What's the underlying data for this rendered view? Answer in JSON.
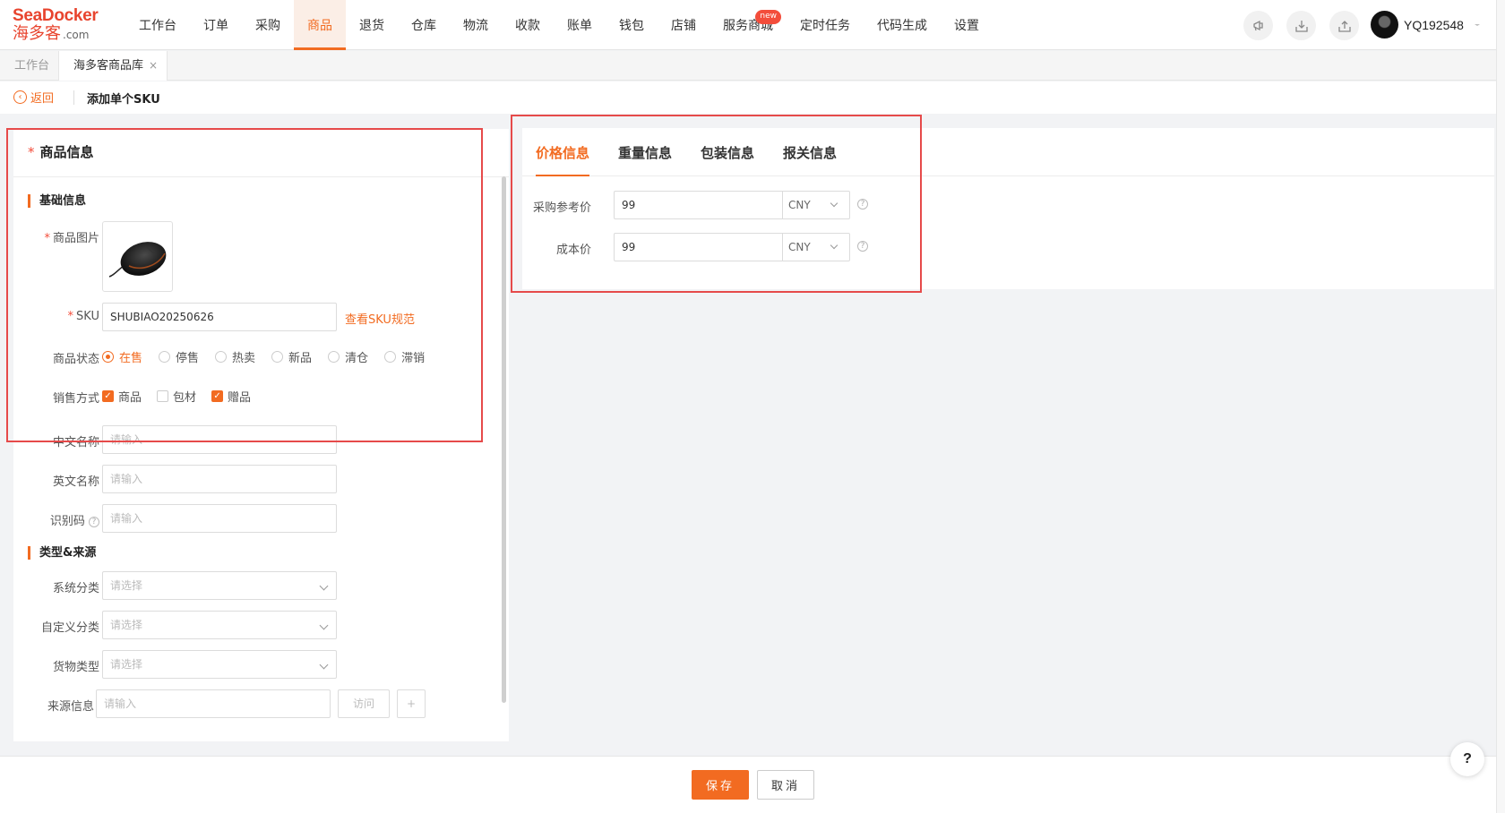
{
  "logo": {
    "line1": "SeaDocker",
    "line2": "海多客",
    "suffix": ".com"
  },
  "nav": {
    "items": [
      {
        "label": "工作台"
      },
      {
        "label": "订单"
      },
      {
        "label": "采购"
      },
      {
        "label": "商品"
      },
      {
        "label": "退货"
      },
      {
        "label": "仓库"
      },
      {
        "label": "物流"
      },
      {
        "label": "收款"
      },
      {
        "label": "账单"
      },
      {
        "label": "钱包"
      },
      {
        "label": "店铺"
      },
      {
        "label": "服务商城"
      },
      {
        "label": "定时任务"
      },
      {
        "label": "代码生成"
      },
      {
        "label": "设置"
      }
    ],
    "active": "商品",
    "badge_item": "服务商城",
    "badge": "new"
  },
  "top_icons": [
    "megaphone-icon",
    "download-icon",
    "upload-icon"
  ],
  "user": {
    "name": "YQ192548"
  },
  "tabs": [
    {
      "label": "工作台"
    },
    {
      "label": "海多客商品库",
      "close": "×"
    }
  ],
  "breadcrumb": {
    "back": "返回",
    "title": "添加单个SKU"
  },
  "product_info": {
    "title": "商品信息",
    "required_mark": "*",
    "basic_section": "基础信息",
    "image_label": "商品图片",
    "sku_label": "SKU",
    "sku_value": "SHUBIAO20250626",
    "sku_link": "查看SKU规范",
    "status_label": "商品状态",
    "status_options": [
      "在售",
      "停售",
      "热卖",
      "新品",
      "清仓",
      "滞销"
    ],
    "status_selected": "在售",
    "sale_label": "销售方式",
    "sale_options": [
      {
        "label": "商品",
        "checked": true
      },
      {
        "label": "包材",
        "checked": false
      },
      {
        "label": "赠品",
        "checked": true
      }
    ],
    "cn_name_label": "中文名称",
    "en_name_label": "英文名称",
    "code_label": "识别码",
    "input_placeholder": "请输入",
    "type_section": "类型&来源",
    "sys_cat_label": "系统分类",
    "custom_cat_label": "自定义分类",
    "goods_type_label": "货物类型",
    "select_placeholder": "请选择",
    "source_label": "来源信息",
    "source_btn": "访问",
    "source_add": "+"
  },
  "price_panel": {
    "tabs": [
      "价格信息",
      "重量信息",
      "包装信息",
      "报关信息"
    ],
    "active_tab": "价格信息",
    "rows": [
      {
        "label": "采购参考价",
        "value": "99",
        "currency": "CNY"
      },
      {
        "label": "成本价",
        "value": "99",
        "currency": "CNY"
      }
    ]
  },
  "footer": {
    "save": "保存",
    "cancel": "取消"
  },
  "help_fab": "?",
  "colors": {
    "accent": "#f26b21",
    "highlight": "#e64a4a",
    "required": "#f34d3b"
  }
}
